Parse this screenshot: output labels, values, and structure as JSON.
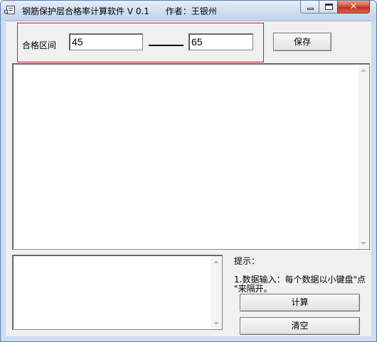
{
  "window": {
    "title": "钢筋保护层合格率计算软件 V 0.1      作者：王银州",
    "close_symbol": "✕"
  },
  "range": {
    "label": "合格区间",
    "min_value": "45",
    "max_value": "65"
  },
  "buttons": {
    "save": "保存",
    "calculate": "计算",
    "clear": "清空"
  },
  "input_area": {
    "value": ""
  },
  "result_area": {
    "value": ""
  },
  "tips": {
    "heading": "提示：",
    "line1": "1.数据输入：每个数据以小键盘\"点",
    "line2": "\"来隔开。"
  }
}
